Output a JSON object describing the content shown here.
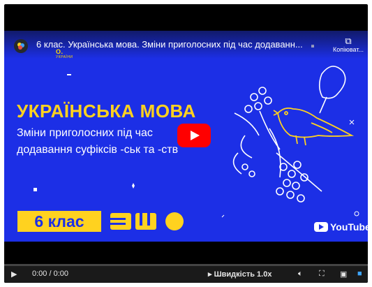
{
  "video": {
    "title": "6 клас. Українська мова. Зміни приголосних під час додаванн...",
    "copy_label": "Копіюват...",
    "brand": "О.",
    "brand_sub": "УКРАЇНИ",
    "subject": "УКРАЇНСЬКА МОВА",
    "topic_line1": "Зміни приголосних під час",
    "topic_line2": "додавання суфіксів -ськ та -ств",
    "grade": "6 клас",
    "youtube": "YouTube"
  },
  "controls": {
    "time": "0:00 / 0:00",
    "speed": "Швидкість 1.0x",
    "progress": 0
  },
  "colors": {
    "background": "#1c2fe6",
    "accent": "#ffd21f",
    "play": "#ff0000"
  },
  "icons": [
    "play-icon",
    "volume-icon",
    "fullscreen-icon",
    "captions-icon",
    "settings-icon",
    "copy-icon"
  ]
}
